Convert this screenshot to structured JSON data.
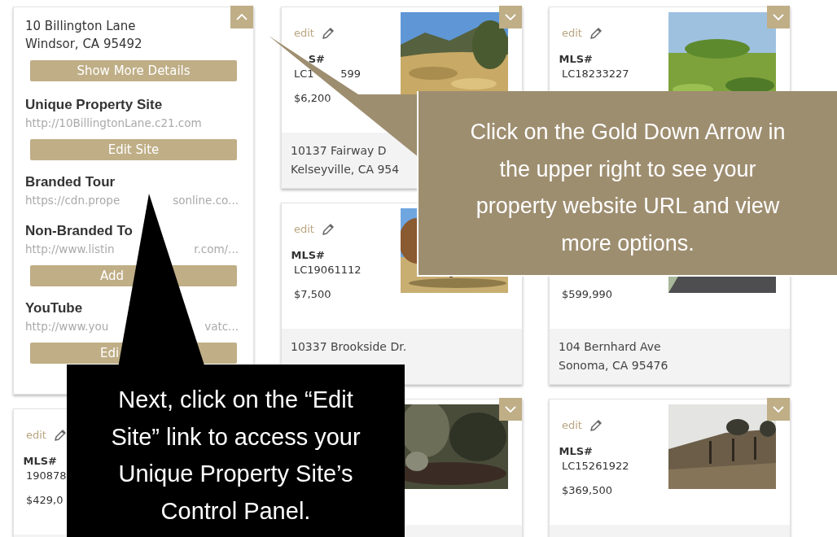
{
  "columns": [
    {
      "cards": [
        {
          "kind": "expanded",
          "expanded": true,
          "address_lines": [
            "10 Billington Lane",
            "Windsor, CA 95492"
          ],
          "show_more_button": "Show More Details",
          "sections": [
            {
              "title": "Unique Property Site",
              "url": [
                "http://10BillingtonLane.c21.com"
              ],
              "button": "Edit Site"
            },
            {
              "title": "Branded Tour",
              "url": [
                "https://cdn.prope",
                "sonline.co..."
              ]
            },
            {
              "title": "Non-Branded To",
              "url": [
                "http://www.listin",
                "r.com/..."
              ],
              "button": [
                "Add"
              ]
            },
            {
              "title": "YouTube",
              "url": [
                "http://www.you",
                "vatc..."
              ],
              "button": [
                "Edi"
              ]
            }
          ]
        },
        {
          "kind": "listing",
          "edit_label": "edit",
          "mls_label": "MLS#",
          "mls_number": [
            "190878"
          ],
          "price": "$429,0"
        }
      ]
    },
    {
      "cards": [
        {
          "kind": "listing",
          "expanded": false,
          "edit_label": "edit",
          "mls_label": "S#",
          "mls_number": [
            "LC1",
            "599"
          ],
          "price": "$6,200",
          "photo": {
            "kind": "picture"
          },
          "address_lines": [
            "10137 Fairway D",
            "Kelseyville, CA 954"
          ]
        },
        {
          "kind": "listing",
          "edit_label": "edit",
          "mls_label": "MLS#",
          "mls_number": [
            "LC19061112"
          ],
          "price": "$7,500",
          "photo": {
            "kind": "picture"
          },
          "address_lines": [
            "10337 Brookside Dr."
          ]
        },
        {
          "kind": "listing",
          "expanded": false,
          "photo": {
            "kind": "picture"
          }
        }
      ]
    },
    {
      "cards": [
        {
          "kind": "listing",
          "expanded": false,
          "edit_label": "edit",
          "mls_label": "MLS#",
          "mls_number": [
            "LC18233227"
          ],
          "photo": {
            "kind": "picture"
          }
        },
        {
          "kind": "listing",
          "price": "$599,990",
          "photo": {
            "kind": "picture"
          },
          "address_lines": [
            "104 Bernhard Ave",
            "Sonoma, CA 95476"
          ]
        },
        {
          "kind": "listing",
          "expanded": false,
          "edit_label": "edit",
          "mls_label": "MLS#",
          "mls_number": [
            "LC15261922"
          ],
          "price": "$369,500",
          "photo": {
            "kind": "picture"
          }
        }
      ]
    }
  ],
  "callouts": [
    {
      "kind": "gold",
      "text": "Click on the Gold Down Arrow in the upper right to see your property website URL and view more options."
    },
    {
      "kind": "black",
      "text": "Next, click on the “Edit Site” link to access your Unique Property Site’s Control Panel."
    }
  ]
}
